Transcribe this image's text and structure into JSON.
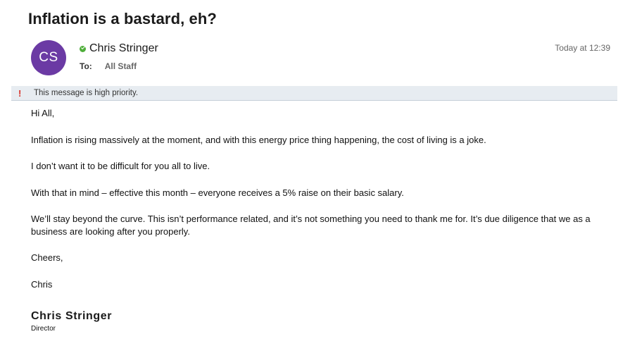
{
  "email": {
    "subject": "Inflation is a bastard, eh?",
    "sender": {
      "initials": "CS",
      "name": "Chris Stringer",
      "presence": "available",
      "avatar_color": "#6b3aa4",
      "presence_color": "#4fae3a"
    },
    "to_label": "To:",
    "to_value": "All Staff",
    "timestamp": "Today at 12:39",
    "priority": {
      "icon": "exclamation-icon",
      "text": "This message is high priority.",
      "color": "#d8322a"
    },
    "body": {
      "greeting": "Hi All,",
      "paragraphs": [
        "Inflation is rising massively at the moment, and with this energy price thing happening, the cost of living is a joke.",
        "I don’t want it to be difficult for you all to live.",
        "With that in mind – effective this month – everyone receives a 5% raise on their basic salary.",
        "We’ll stay beyond the curve. This isn’t performance related, and it’s not something you need to thank me for. It’s due diligence that we as a business are looking after you properly."
      ],
      "closing": "Cheers,",
      "signoff": "Chris"
    },
    "signature": {
      "name": "Chris Stringer",
      "title": "Director"
    }
  }
}
